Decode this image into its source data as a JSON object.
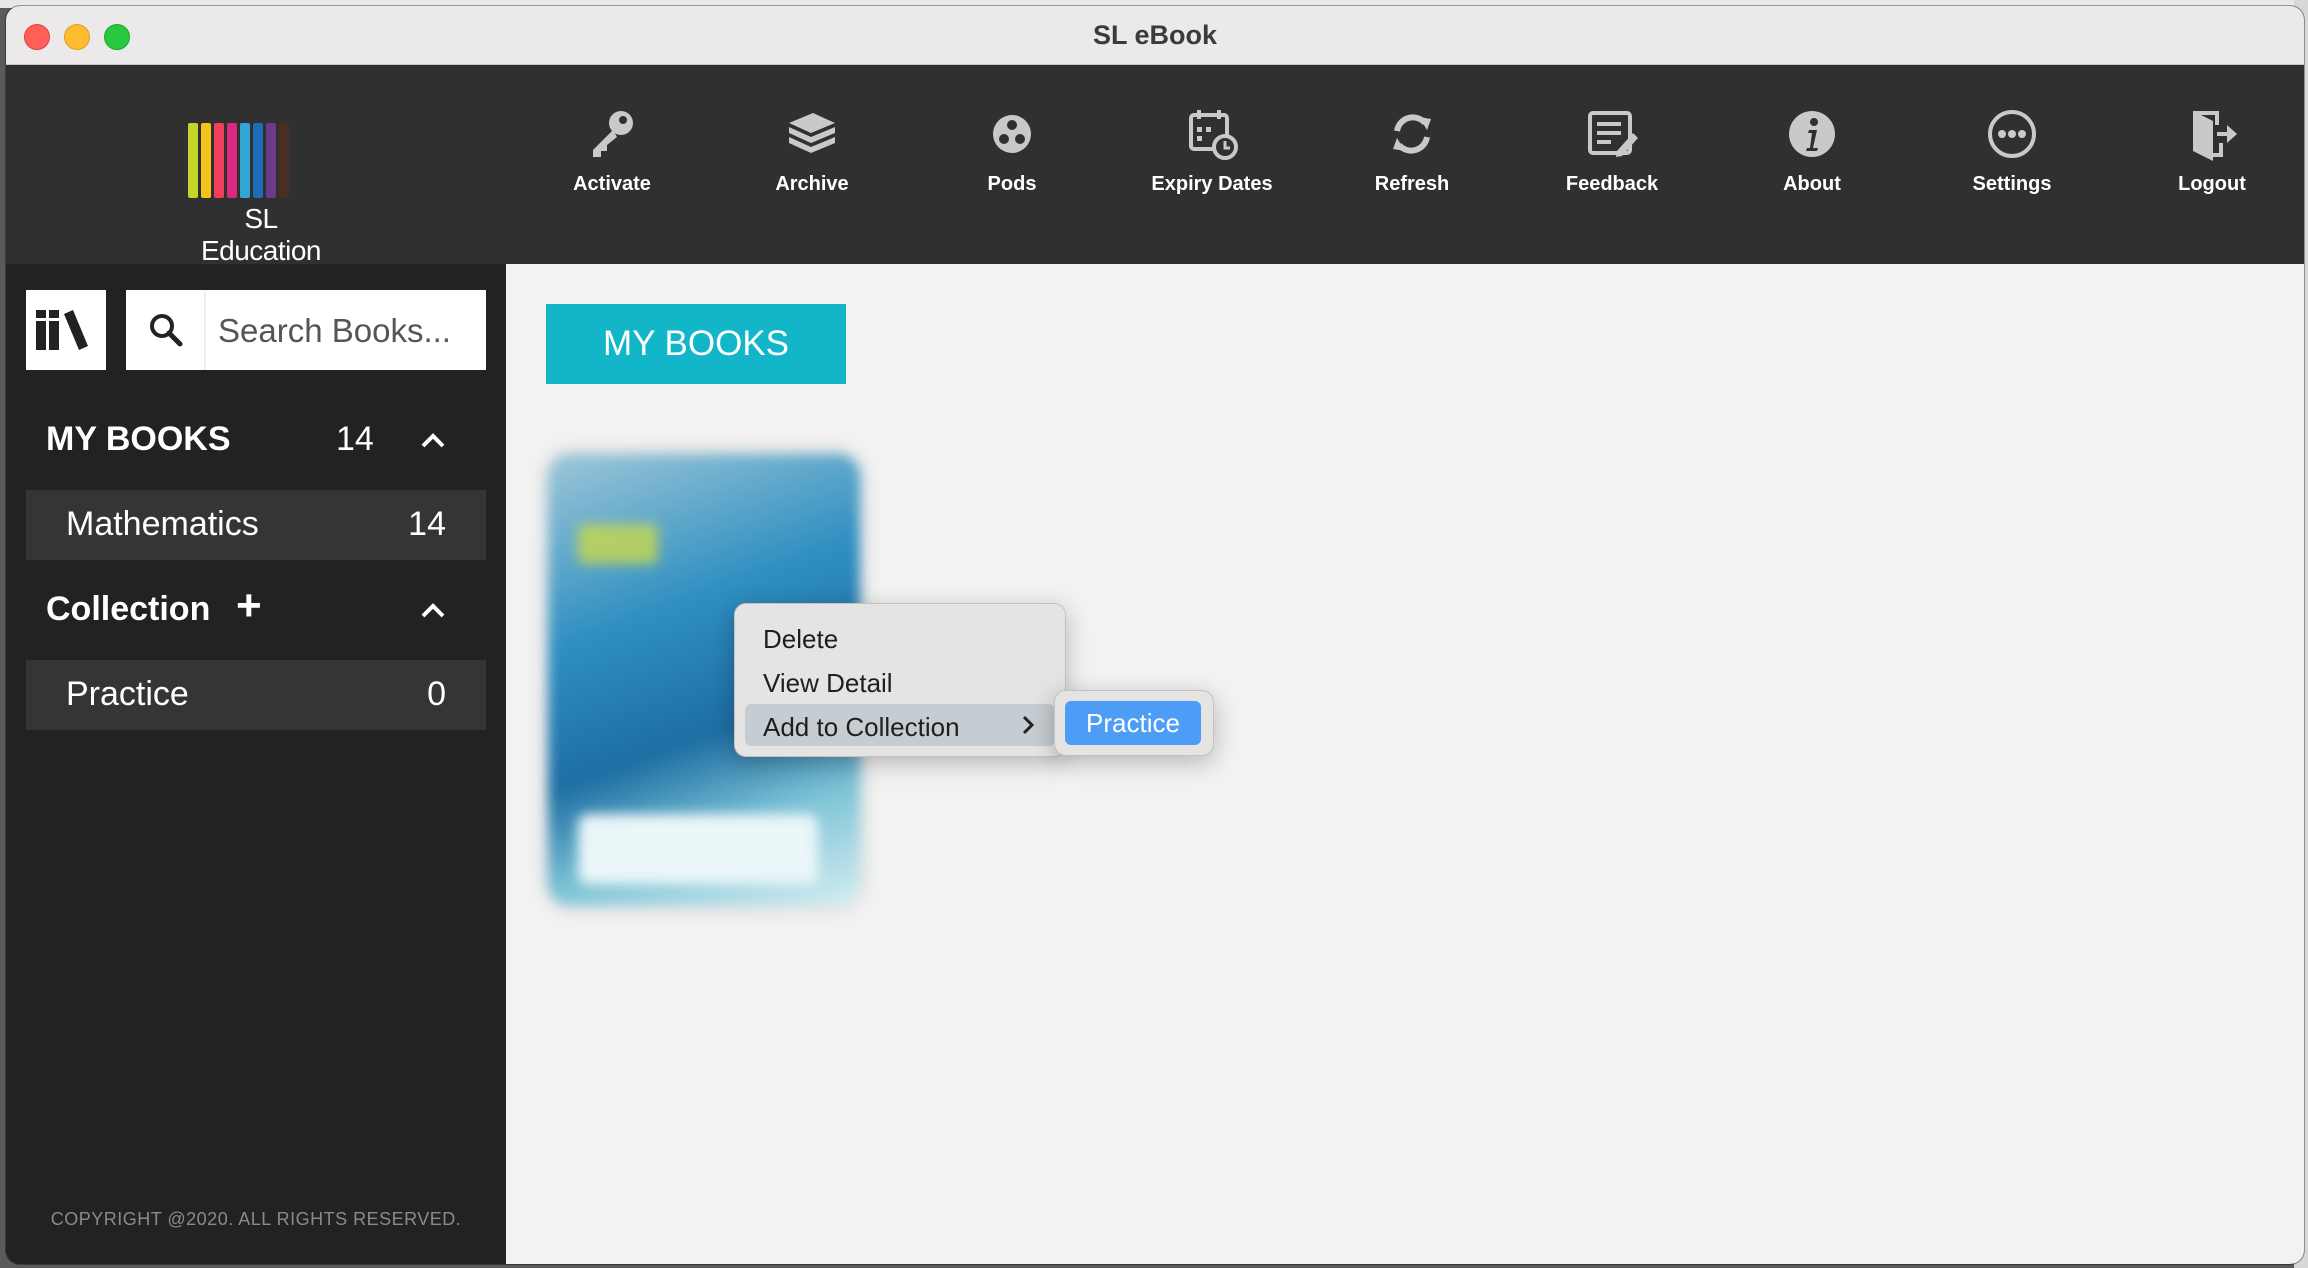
{
  "window": {
    "title": "SL eBook"
  },
  "logo": {
    "text": "SL Education",
    "bar_colors": [
      "#c7d52b",
      "#f2c319",
      "#ef3f5b",
      "#d8297f",
      "#2fa6d5",
      "#1e6bb8",
      "#6b3a8c",
      "#4a2e24"
    ]
  },
  "toolbar": {
    "items": [
      {
        "label": "Activate",
        "icon": "key-icon"
      },
      {
        "label": "Archive",
        "icon": "archive-icon"
      },
      {
        "label": "Pods",
        "icon": "pods-icon"
      },
      {
        "label": "Expiry Dates",
        "icon": "calendar-clock-icon"
      },
      {
        "label": "Refresh",
        "icon": "refresh-icon"
      },
      {
        "label": "Feedback",
        "icon": "feedback-icon"
      },
      {
        "label": "About",
        "icon": "info-icon"
      },
      {
        "label": "Settings",
        "icon": "more-icon"
      },
      {
        "label": "Logout",
        "icon": "logout-icon"
      }
    ]
  },
  "sidebar": {
    "search_placeholder": "Search Books...",
    "my_books": {
      "title": "MY BOOKS",
      "count": "14"
    },
    "my_books_items": [
      {
        "label": "Mathematics",
        "count": "14"
      }
    ],
    "collection": {
      "title": "Collection",
      "add": "+"
    },
    "collection_items": [
      {
        "label": "Practice",
        "count": "0"
      }
    ],
    "copyright": "COPYRIGHT @2020. ALL RIGHTS RESERVED."
  },
  "main": {
    "tab_label": "MY BOOKS"
  },
  "context_menu": {
    "items": [
      "Delete",
      "View Detail",
      "Add to Collection"
    ],
    "submenu": [
      "Practice"
    ]
  },
  "colors": {
    "accent": "#13b5c9",
    "selection": "#4d9df6",
    "toolbar_bg": "#303030",
    "sidebar_bg": "#222222"
  }
}
